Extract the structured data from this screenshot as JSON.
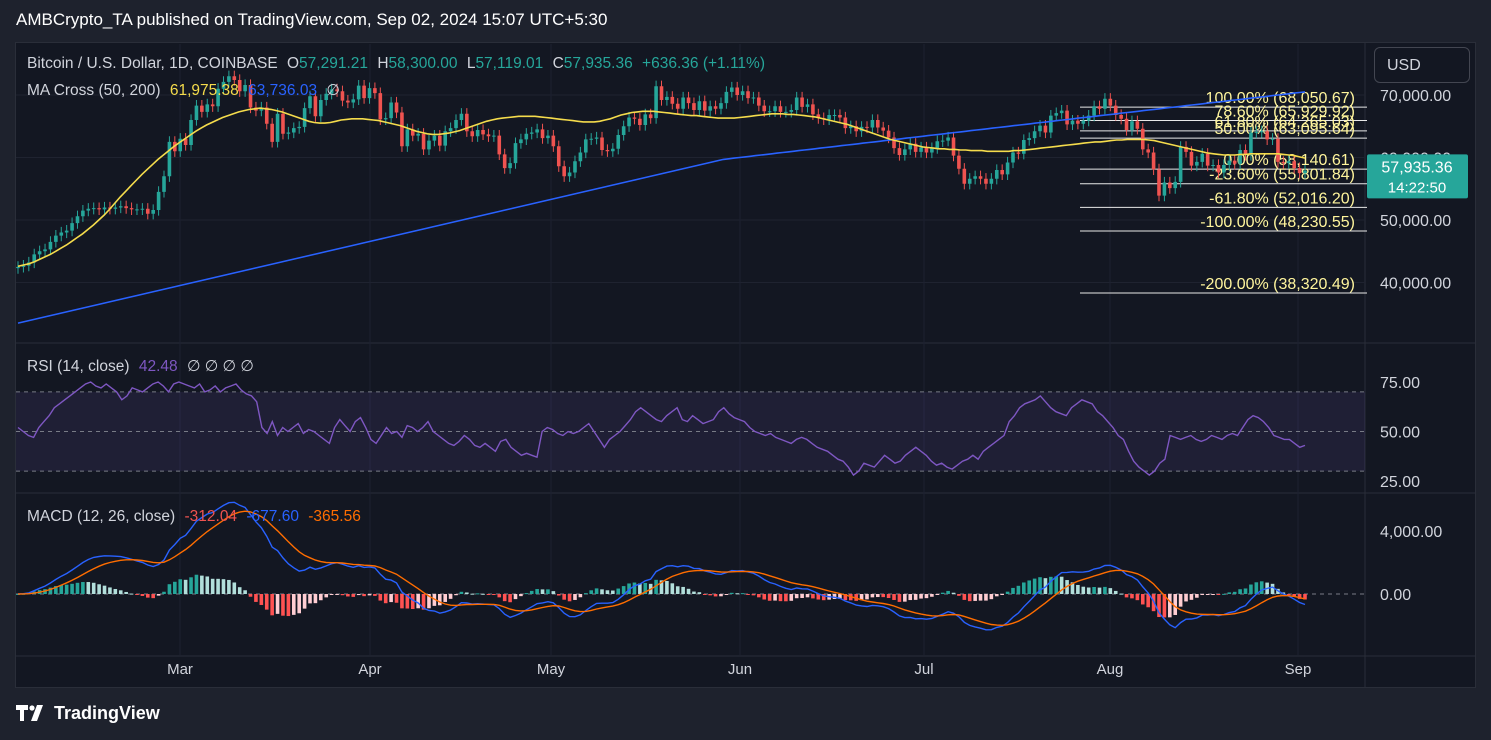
{
  "header": {
    "publisher": "AMBCrypto_TA published on TradingView.com, Sep 02, 2024 15:07 UTC+5:30"
  },
  "currency_button": "USD",
  "legend": {
    "symbol": "Bitcoin / U.S. Dollar, 1D, COINBASE",
    "open_label": "O",
    "open": "57,291.21",
    "high_label": "H",
    "high": "58,300.00",
    "low_label": "L",
    "low": "57,119.01",
    "close_label": "C",
    "close": "57,935.36",
    "change": "+636.36 (+1.11%)",
    "ma_label": "MA Cross (50, 200)",
    "ma50": "61,975.38",
    "ma200": "63,736.03",
    "ma_extra": "∅",
    "rsi_label": "RSI (14, close)",
    "rsi_value": "42.48",
    "rsi_extra": "∅ ∅ ∅ ∅",
    "macd_label": "MACD (12, 26, close)",
    "macd": "-312.04",
    "signal": "-677.60",
    "hist": "-365.56"
  },
  "price_tag": {
    "price": "57,935.36",
    "countdown": "14:22:50"
  },
  "colors": {
    "up": "#26a69a",
    "down": "#ef5350",
    "ma50": "#f5dc4c",
    "ma200": "#2962ff",
    "rsi": "#7e57c2",
    "macd": "#2962ff",
    "signal": "#ff6d00",
    "fib_text": "#fff59d"
  },
  "footer": {
    "brand": "TradingView"
  },
  "chart_data": [
    {
      "type": "candlestick",
      "title": "Bitcoin / U.S. Dollar, 1D, COINBASE",
      "x_ticks": [
        "Mar",
        "Apr",
        "May",
        "Jun",
        "Jul",
        "Aug",
        "Sep"
      ],
      "y_ticks": [
        "70,000.00",
        "60,000.00",
        "50,000.00",
        "40,000.00"
      ],
      "ylim": [
        36000,
        75000
      ],
      "close_series": [
        42500,
        42700,
        43200,
        44500,
        45000,
        45300,
        46500,
        47500,
        48000,
        48300,
        49500,
        50600,
        51500,
        51800,
        51900,
        51700,
        52000,
        51800,
        52000,
        52200,
        51900,
        51700,
        51700,
        51800,
        51000,
        51600,
        54500,
        57000,
        62500,
        61000,
        63000,
        62000,
        66000,
        68300,
        67300,
        68500,
        68200,
        71000,
        72100,
        73000,
        72400,
        70600,
        71600,
        68000,
        67500,
        68000,
        65400,
        62500,
        67000,
        63800,
        64000,
        64700,
        64900,
        67900,
        69800,
        66600,
        69200,
        70200,
        70900,
        70600,
        69100,
        68800,
        69300,
        71500,
        69500,
        71100,
        70300,
        66100,
        66300,
        68800,
        67200,
        61800,
        64500,
        63500,
        63800,
        61300,
        62700,
        63500,
        61900,
        64200,
        64700,
        66000,
        67000,
        64200,
        63400,
        64400,
        63700,
        63400,
        63500,
        60500,
        58300,
        59100,
        62300,
        62900,
        63800,
        64000,
        64500,
        63100,
        63500,
        61800,
        58600,
        57000,
        57600,
        59400,
        60800,
        62900,
        63000,
        63200,
        61200,
        61000,
        61400,
        63600,
        65000,
        66400,
        66200,
        65200,
        66900,
        66300,
        71400,
        69200,
        69700,
        68600,
        67800,
        69600,
        68700,
        67600,
        69000,
        67500,
        68200,
        67800,
        68700,
        70500,
        71200,
        70000,
        70600,
        69500,
        69600,
        68300,
        67400,
        67400,
        68200,
        67300,
        67300,
        67600,
        69600,
        68100,
        68500,
        66900,
        66300,
        66100,
        66800,
        66800,
        66400,
        64700,
        65000,
        64200,
        64900,
        64800,
        66000,
        64800,
        64300,
        63200,
        61500,
        60400,
        61300,
        62200,
        60900,
        61600,
        60800,
        61500,
        62600,
        62700,
        63200,
        60300,
        58200,
        55800,
        56600,
        57000,
        56600,
        55800,
        56600,
        58000,
        57300,
        59200,
        60800,
        60600,
        62800,
        63100,
        64200,
        65100,
        64000,
        66700,
        67100,
        67500,
        65300,
        65900,
        65400,
        65900,
        66700,
        68200,
        67800,
        69400,
        68300,
        66800,
        66200,
        64400,
        65800,
        64600,
        61300,
        60800,
        58100,
        53900,
        56000,
        55100,
        56100,
        61700,
        60900,
        58700,
        59300,
        60600,
        58700,
        58800,
        57600,
        58800,
        59500,
        59000,
        61200,
        60400,
        64000,
        64100,
        64200,
        62900,
        63000,
        59300,
        59100,
        59400,
        58300,
        57500,
        57900
      ],
      "ma50_series": [
        42600,
        42800,
        43000,
        43300,
        43700,
        44100,
        44500,
        45000,
        45500,
        46000,
        46600,
        47200,
        47800,
        48500,
        49200,
        50000,
        50800,
        51700,
        52700,
        53700,
        54600,
        55500,
        56400,
        57300,
        58100,
        58900,
        59700,
        60400,
        61100,
        61800,
        62400,
        63000,
        63600,
        64200,
        64700,
        65200,
        65600,
        66000,
        66400,
        66700,
        67000,
        67300,
        67500,
        67700,
        67800,
        67900,
        67800,
        67700,
        67500,
        67300,
        67000,
        66700,
        66400,
        66100,
        65800,
        65600,
        65500,
        65500,
        65600,
        65800,
        66000,
        66100,
        66200,
        66200,
        66200,
        66100,
        66000,
        65900,
        65700,
        65500,
        65300,
        65100,
        64800,
        64500,
        64200,
        64000,
        63800,
        63700,
        63700,
        63800,
        63900,
        64100,
        64300,
        64600,
        64900,
        65200,
        65500,
        65800,
        66000,
        66200,
        66300,
        66400,
        66500,
        66600,
        66600,
        66600,
        66600,
        66500,
        66400,
        66300,
        66200,
        66100,
        66000,
        65900,
        65800,
        65700,
        65700,
        65700,
        65800,
        66000,
        66200,
        66500,
        66800,
        67000,
        67200,
        67300,
        67400,
        67400,
        67400,
        67300,
        67200,
        67100,
        67000,
        66900,
        66800,
        66700,
        66700,
        66600,
        66500,
        66400,
        66300,
        66300,
        66300,
        66300,
        66400,
        66500,
        66600,
        66700,
        66800,
        66900,
        67000,
        67000,
        67000,
        66900,
        66900,
        66800,
        66700,
        66600,
        66500,
        66300,
        66100,
        65900,
        65700,
        65500,
        65300,
        65000,
        64700,
        64400,
        64100,
        63800,
        63500,
        63200,
        62900,
        62700,
        62500,
        62300,
        62100,
        61900,
        61700,
        61600,
        61500,
        61400,
        61400,
        61300,
        61300,
        61200,
        61200,
        61100,
        61100,
        61100,
        61000,
        61000,
        61000,
        61000,
        61000,
        61100,
        61100,
        61200,
        61300,
        61400,
        61500,
        61600,
        61700,
        61800,
        61900,
        62000,
        62100,
        62200,
        62300,
        62400,
        62500,
        62500,
        62600,
        62700,
        62800,
        62800,
        62900,
        62900,
        62900,
        62900,
        62800,
        62700,
        62500,
        62300,
        62100,
        61900,
        61700,
        61500,
        61300,
        61100,
        60900,
        60700,
        60600,
        60500,
        60400,
        60400,
        60400,
        60500,
        60500,
        60600,
        60600,
        60600,
        60600,
        60600,
        60600,
        60500,
        60400,
        60300,
        60100,
        59900
      ],
      "ma200_series": [
        33500,
        33700,
        33900,
        34100,
        34300,
        34500,
        34700,
        34900,
        35100,
        35300,
        35500,
        35700,
        35900,
        36100,
        36300,
        36500,
        36700,
        36900,
        37100,
        37300,
        37500,
        37700,
        37900,
        38100,
        38300,
        38500,
        38700,
        38900,
        39100,
        39300,
        39500,
        39700,
        39900,
        40100,
        40300,
        40500,
        40700,
        40900,
        41100,
        41300,
        41500,
        41700,
        41900,
        42100,
        42300,
        42500,
        42700,
        42900,
        43100,
        43300,
        43500,
        43700,
        43900,
        44100,
        44300,
        44500,
        44700,
        44900,
        45100,
        45300,
        45500,
        45700,
        45900,
        46100,
        46300,
        46500,
        46700,
        46900,
        47100,
        47300,
        47500,
        47700,
        47900,
        48100,
        48300,
        48500,
        48700,
        48900,
        49100,
        49300,
        49500,
        49700,
        49900,
        50100,
        50300,
        50500,
        50700,
        50900,
        51100,
        51300,
        51500,
        51700,
        51900,
        52100,
        52300,
        52500,
        52700,
        52900,
        53100,
        53300,
        53500,
        53700,
        53900,
        54100,
        54300,
        54500,
        54700,
        54900,
        55100,
        55300,
        55500,
        55700,
        55900,
        56100,
        56300,
        56500,
        56700,
        56900,
        57100,
        57300,
        57500,
        57700,
        57900,
        58100,
        58300,
        58500,
        58700,
        58900,
        59100,
        59300,
        59500,
        59700,
        59800,
        59900,
        60000,
        60100,
        60200,
        60300,
        60400,
        60500,
        60600,
        60700,
        60800,
        60900,
        61000,
        61100,
        61200,
        61300,
        61400,
        61500,
        61600,
        61700,
        61800,
        61900,
        62000,
        62100,
        62200,
        62300,
        62400,
        62500,
        62600,
        62700,
        62800,
        62900,
        63000,
        63100,
        63200,
        63300,
        63400,
        63500,
        63600,
        63700,
        63800,
        63900,
        64000,
        64100,
        64200,
        64300,
        64400,
        64500,
        64600,
        64700,
        64800,
        64900,
        65000,
        65100,
        65200,
        65300,
        65400,
        65500,
        65600,
        65700,
        65800,
        65900,
        66000,
        66100,
        66200,
        66300,
        66400,
        66500,
        66600,
        66700,
        66800,
        66900,
        67000,
        67100,
        67200,
        67300,
        67400,
        67500,
        67600,
        67700,
        67800,
        67900,
        68000,
        68100,
        68200,
        68300,
        68400,
        68500,
        68600,
        68700,
        68800,
        68900,
        69000,
        69100,
        69200,
        69300,
        69400,
        69500,
        69600,
        69700,
        69800,
        69900,
        70000,
        70100,
        70200,
        70300,
        70400,
        70500
      ],
      "fib_levels": [
        {
          "label": "100.00% (68,050.67)",
          "value": 68050.67
        },
        {
          "label": "78.60% (65,929.92)",
          "value": 65929.92
        },
        {
          "label": "61.80% (64,265.03)",
          "value": 64265.03
        },
        {
          "label": "50.00% (63,095.64)",
          "value": 63095.64
        },
        {
          "label": "0.00% (58,140.61)",
          "value": 58140.61
        },
        {
          "label": "-23.60% (55,801.84)",
          "value": 55801.84
        },
        {
          "label": "-61.80% (52,016.20)",
          "value": 52016.2
        },
        {
          "label": "-100.00% (48,230.55)",
          "value": 48230.55
        },
        {
          "label": "-200.00% (38,320.49)",
          "value": 38320.49
        }
      ]
    },
    {
      "type": "line",
      "title": "RSI (14, close)",
      "y_ticks": [
        "75.00",
        "50.00",
        "25.00"
      ],
      "bands": [
        70,
        50,
        30
      ],
      "values": [
        52,
        50,
        48,
        47,
        52,
        55,
        58,
        62,
        64,
        66,
        68,
        70,
        72,
        74,
        75,
        73,
        72,
        74,
        72,
        70,
        66,
        68,
        72,
        71,
        70,
        72,
        74,
        75,
        73,
        70,
        74,
        75,
        74,
        73,
        72,
        74,
        70,
        71,
        73,
        70,
        72,
        73,
        74,
        71,
        69,
        68,
        65,
        52,
        49,
        55,
        48,
        52,
        50,
        52,
        54,
        49,
        51,
        50,
        48,
        46,
        44,
        52,
        56,
        53,
        50,
        55,
        57,
        52,
        46,
        44,
        48,
        52,
        49,
        50,
        47,
        53,
        52,
        50,
        52,
        55,
        50,
        48,
        46,
        44,
        43,
        45,
        48,
        46,
        43,
        42,
        44,
        42,
        40,
        45,
        46,
        42,
        40,
        38,
        39,
        38,
        37,
        50,
        52,
        51,
        49,
        48,
        50,
        49,
        50,
        52,
        54,
        50,
        46,
        42,
        46,
        48,
        50,
        53,
        56,
        60,
        62,
        60,
        58,
        56,
        55,
        58,
        60,
        62,
        56,
        55,
        58,
        56,
        54,
        55,
        56,
        60,
        62,
        59,
        57,
        56,
        55,
        52,
        50,
        49,
        48,
        49,
        47,
        46,
        45,
        44,
        46,
        47,
        46,
        44,
        42,
        41,
        40,
        38,
        36,
        35,
        32,
        28,
        30,
        34,
        33,
        32,
        35,
        38,
        36,
        34,
        35,
        38,
        40,
        42,
        40,
        38,
        35,
        33,
        34,
        32,
        31,
        33,
        35,
        36,
        38,
        36,
        40,
        42,
        44,
        46,
        48,
        55,
        58,
        62,
        64,
        65,
        66,
        68,
        65,
        62,
        60,
        59,
        58,
        62,
        64,
        66,
        65,
        64,
        60,
        58,
        55,
        52,
        48,
        46,
        40,
        35,
        32,
        30,
        28,
        30,
        34,
        36,
        48,
        47,
        46,
        47,
        48,
        46,
        45,
        46,
        48,
        47,
        46,
        48,
        49,
        48,
        52,
        56,
        58,
        57,
        55,
        52,
        48,
        47,
        46,
        46,
        44,
        42,
        43
      ]
    },
    {
      "type": "line",
      "title": "MACD (12, 26, close)",
      "y_ticks": [
        "4,000.00",
        "0.00"
      ]
    }
  ]
}
